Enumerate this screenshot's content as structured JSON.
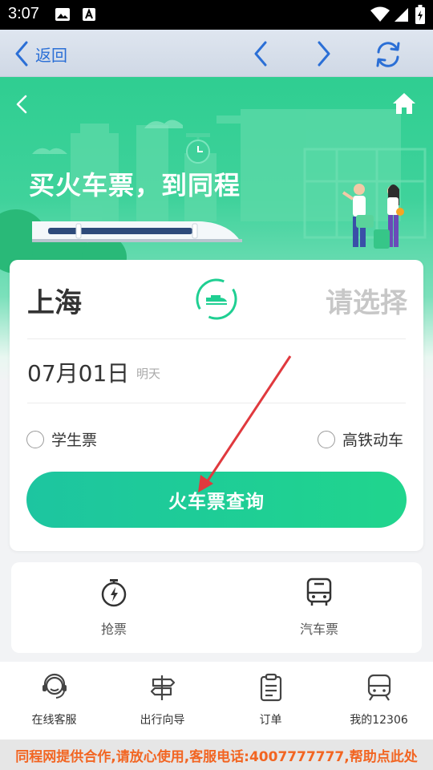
{
  "status_bar": {
    "time": "3:07",
    "icons": [
      "image-icon",
      "font-icon",
      "wifi-icon",
      "signal-icon",
      "battery-icon"
    ]
  },
  "nav": {
    "back_label": "返回",
    "icons": [
      "back-chevron-icon",
      "prev-icon",
      "next-icon",
      "refresh-icon"
    ]
  },
  "banner": {
    "title": "买火车票，到同程"
  },
  "search": {
    "from": "上海",
    "to_placeholder": "请选择",
    "date": "07月01日",
    "date_sub": "明天",
    "option_student": "学生票",
    "option_highspeed": "高铁动车",
    "search_button": "火车票查询"
  },
  "services": [
    {
      "label": "抢票",
      "icon": "stopwatch-icon"
    },
    {
      "label": "汽车票",
      "icon": "bus-icon"
    }
  ],
  "tabs": [
    {
      "label": "在线客服",
      "icon": "headset-icon"
    },
    {
      "label": "出行向导",
      "icon": "signpost-icon"
    },
    {
      "label": "订单",
      "icon": "clipboard-icon"
    },
    {
      "label": "我的12306",
      "icon": "train-icon"
    }
  ],
  "footer": {
    "text": "同程网提供合作,请放心使用,客服电话:4007777777,帮助点此处"
  },
  "colors": {
    "accent": "#1fcf92",
    "nav_blue": "#2b6fd6",
    "footer_text": "#f26522",
    "annotation_arrow": "#e0393e"
  }
}
